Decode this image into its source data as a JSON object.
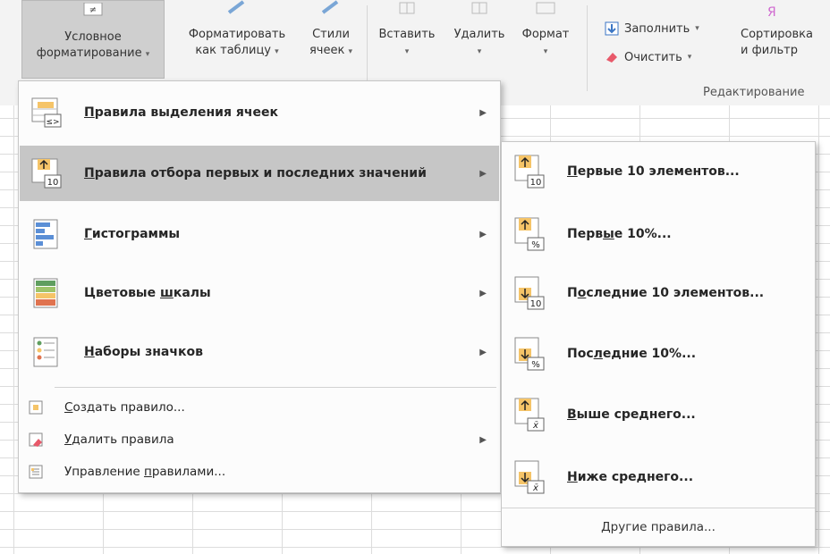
{
  "ribbon": {
    "cf_button": "Условное\nформатирование",
    "format_table": "Форматировать\nкак таблицу",
    "cell_styles": "Стили\nячеек",
    "insert": "Вставить",
    "delete": "Удалить",
    "format": "Формат",
    "fill": "Заполнить",
    "clear": "Очистить",
    "sort_filter": "Сортировка\nи фильтр",
    "editing_group": "Редактирование"
  },
  "main_menu": {
    "items": [
      {
        "label": "Правила выделения ячеек",
        "icon": "highlight-rules-icon",
        "hotkey_index": 0
      },
      {
        "label": "Правила отбора первых и последних значений",
        "icon": "top-bottom-rules-icon",
        "hotkey_index": 0
      },
      {
        "label": "Гистограммы",
        "icon": "data-bars-icon",
        "hotkey_index": 0
      },
      {
        "label": "Цветовые шкалы",
        "icon": "color-scales-icon",
        "hotkey_index": 9
      },
      {
        "label": "Наборы значков",
        "icon": "icon-sets-icon",
        "hotkey_index": 0
      }
    ],
    "small_items": [
      {
        "label": "Создать правило...",
        "icon": "new-rule-icon",
        "hotkey_index": 0
      },
      {
        "label": "Удалить правила",
        "icon": "clear-rules-icon",
        "hotkey_index": 0
      },
      {
        "label": "Управление правилами...",
        "icon": "manage-rules-icon",
        "hotkey_index": 11
      }
    ]
  },
  "sub_menu": {
    "items": [
      {
        "label": "Первые 10 элементов...",
        "icon": "top-10-items-icon",
        "hotkey_index": 0
      },
      {
        "label": "Первые 10%...",
        "icon": "top-10-percent-icon",
        "hotkey_index": 4
      },
      {
        "label": "Последние 10 элементов...",
        "icon": "bottom-10-items-icon",
        "hotkey_index": 1
      },
      {
        "label": "Последние 10%...",
        "icon": "bottom-10-percent-icon",
        "hotkey_index": 3
      },
      {
        "label": "Выше среднего...",
        "icon": "above-average-icon",
        "hotkey_index": 0
      },
      {
        "label": "Ниже среднего...",
        "icon": "below-average-icon",
        "hotkey_index": 0
      }
    ],
    "footer": "Другие правила..."
  },
  "colors": {
    "highlight": "#c6c6c6",
    "icon_orange": "#f5c468",
    "icon_border": "#8a8a8a"
  }
}
